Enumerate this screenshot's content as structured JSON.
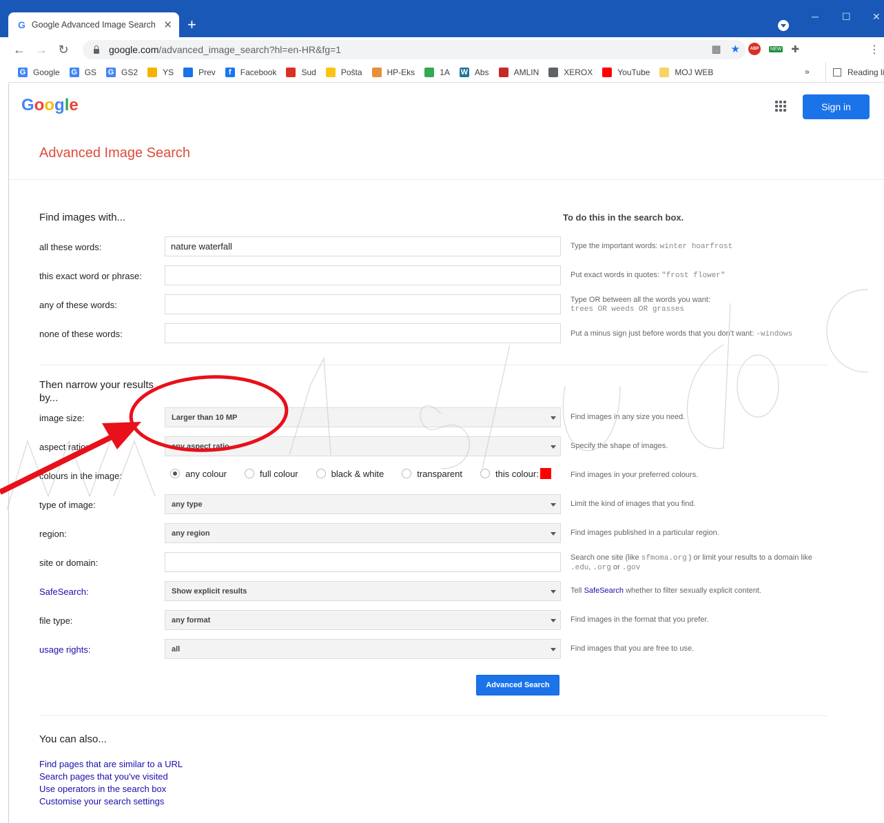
{
  "browser": {
    "tab_title": "Google Advanced Image Search",
    "tab_favicon": "G",
    "url_domain": "google.com",
    "url_path": "/advanced_image_search?hl=en-HR&fg=1",
    "bookmarks": [
      {
        "label": "Google",
        "icon": "G",
        "color": "#4285f4"
      },
      {
        "label": "GS",
        "icon": "G",
        "color": "#4285f4"
      },
      {
        "label": "GS2",
        "icon": "G",
        "color": "#4285f4"
      },
      {
        "label": "YS",
        "icon": "",
        "color": "#f4b400"
      },
      {
        "label": "Prev",
        "icon": "",
        "color": "#1a73e8"
      },
      {
        "label": "Facebook",
        "icon": "f",
        "color": "#1877f2"
      },
      {
        "label": "Sud",
        "icon": "",
        "color": "#d93025"
      },
      {
        "label": "Pošta",
        "icon": "",
        "color": "#f9c513"
      },
      {
        "label": "HP-Eks",
        "icon": "",
        "color": "#e69138"
      },
      {
        "label": "1A",
        "icon": "",
        "color": "#34a853"
      },
      {
        "label": "Abs",
        "icon": "W",
        "color": "#21759b"
      },
      {
        "label": "AMLIN",
        "icon": "",
        "color": "#c62828"
      },
      {
        "label": "XEROX",
        "icon": "",
        "color": "#5f6368"
      },
      {
        "label": "YouTube",
        "icon": "",
        "color": "#ff0000"
      },
      {
        "label": "MOJ WEB",
        "icon": "",
        "color": "#f6d365"
      }
    ],
    "bookmarks_more": "»",
    "reading_list": "Reading list",
    "abp_text": "ABP",
    "new_badge": "NEW"
  },
  "header": {
    "logo": "Google",
    "sign_in": "Sign in"
  },
  "page_title": "Advanced Image Search",
  "find": {
    "heading": "Find images with...",
    "hint_heading": "To do this in the search box.",
    "rows": [
      {
        "label": "all these words:",
        "value": "nature waterfall",
        "hint_text": "Type the important words: ",
        "hint_mono": "winter hoarfrost",
        "hint_mono2": ""
      },
      {
        "label": "this exact word or phrase:",
        "value": "",
        "hint_text": "Put exact words in quotes: ",
        "hint_mono": "\"frost flower\"",
        "hint_mono2": ""
      },
      {
        "label": "any of these words:",
        "value": "",
        "hint_text": "Type OR between all the words you want:",
        "hint_mono": "",
        "hint_mono2": "trees OR weeds OR grasses"
      },
      {
        "label": "none of these words:",
        "value": "",
        "hint_text": "Put a minus sign just before words that you don't want: ",
        "hint_mono": "-windows",
        "hint_mono2": ""
      }
    ]
  },
  "narrow": {
    "heading": "Then narrow your results by...",
    "image_size": {
      "label": "image size:",
      "value": "Larger than 10 MP",
      "hint": "Find images in any size you need."
    },
    "aspect_ratio": {
      "label": "aspect ratio:",
      "value": "any aspect ratio",
      "hint": "Specify the shape of images."
    },
    "colours": {
      "label": "colours in the image:",
      "options": [
        "any colour",
        "full colour",
        "black & white",
        "transparent",
        "this colour:"
      ],
      "selected": "any colour",
      "swatch": "#ff0000",
      "hint": "Find images in your preferred colours."
    },
    "type": {
      "label": "type of image:",
      "value": "any type",
      "hint": "Limit the kind of images that you find."
    },
    "region": {
      "label": "region:",
      "value": "any region",
      "hint": "Find images published in a particular region."
    },
    "site": {
      "label": "site or domain:",
      "value": "",
      "hint_pre": "Search one site (like ",
      "hint_mono1": "sfmoma.org",
      "hint_mid": " ) or limit your results to a domain like ",
      "hint_mono2": ".edu",
      "hint_mono3": ".org",
      "hint_or": " or ",
      "hint_mono4": ".gov"
    },
    "safesearch": {
      "label": "SafeSearch:",
      "value": "Show explicit results",
      "hint_pre": "Tell ",
      "hint_link": "SafeSearch",
      "hint_post": " whether to filter sexually explicit content."
    },
    "file_type": {
      "label": "file type:",
      "value": "any format",
      "hint": "Find images in the format that you prefer."
    },
    "usage_rights": {
      "label": "usage rights:",
      "value": "all",
      "hint": "Find images that you are free to use."
    }
  },
  "advanced_search_button": "Advanced Search",
  "also": {
    "heading": "You can also...",
    "links": [
      "Find pages that are similar to a URL",
      "Search pages that you've visited",
      "Use operators in the search box",
      "Customise your search settings"
    ]
  },
  "colors": {
    "accent_blue": "#1a73e8",
    "title_red": "#dd4b39",
    "annotation_red": "#e8101a",
    "titlebar": "#1a58b7"
  }
}
